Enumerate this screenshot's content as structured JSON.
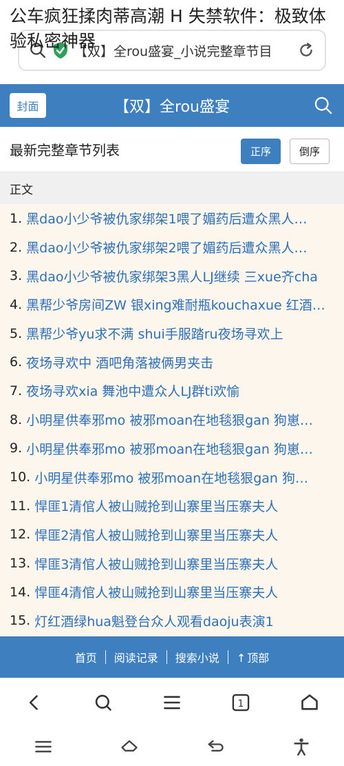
{
  "overlay_title": "公车疯狂揉肉蒂高潮 H 失禁软件：极致体验私密神器",
  "address_bar": {
    "url": "【双】全rou盛宴_小说完整章节目"
  },
  "header": {
    "cover_label": "封面",
    "title": "【双】全rou盛宴"
  },
  "list_head": {
    "title": "最新完整章节列表",
    "sort_asc": "正序",
    "sort_desc": "倒序"
  },
  "section": {
    "label": "正文"
  },
  "chapters": [
    {
      "num": "1.",
      "title": "黑dao小少爷被仇家绑架1喂了媚药后遭众黑人…"
    },
    {
      "num": "2.",
      "title": "黑dao小少爷被仇家绑架2喂了媚药后遭众黑人…"
    },
    {
      "num": "3.",
      "title": "黑dao小少爷被仇家绑架3黑人LJ继续 三xue齐cha"
    },
    {
      "num": "4.",
      "title": "黑帮少爷房间ZW 银xing难耐瓶kouchaxue 红酒…"
    },
    {
      "num": "5.",
      "title": "黑帮少爷yu求不满 shui手服踏ru夜场寻欢上"
    },
    {
      "num": "6.",
      "title": "夜场寻欢中 酒吧角落被俩男夹击"
    },
    {
      "num": "7.",
      "title": "夜场寻欢xia 舞池中遭众人LJ群ti欢愉"
    },
    {
      "num": "8.",
      "title": "小明星供奉邪mo 被邪moan在地毯狠gan 狗崽…"
    },
    {
      "num": "9.",
      "title": "小明星供奉邪mo 被邪moan在地毯狠gan 狗崽…"
    },
    {
      "num": "10.",
      "title": "小明星供奉邪mo 被邪moan在地毯狠gan 狗…"
    },
    {
      "num": "11.",
      "title": "悍匪1清倌人被山贼抢到山寨里当压寨夫人"
    },
    {
      "num": "12.",
      "title": "悍匪2清倌人被山贼抢到山寨里当压寨夫人"
    },
    {
      "num": "13.",
      "title": "悍匪3清倌人被山贼抢到山寨里当压寨夫人"
    },
    {
      "num": "14.",
      "title": "悍匪4清倌人被山贼抢到山寨里当压寨夫人"
    },
    {
      "num": "15.",
      "title": "灯红酒绿hua魁登台众人观看daoju表演1"
    }
  ],
  "footer_nav": {
    "home": "首页",
    "history": "阅读记录",
    "search": "搜索小说",
    "top": "顶部",
    "top_arrow": "↑"
  },
  "browser_bar": {
    "tab_count": "1",
    "icons": [
      "back-icon",
      "search-icon",
      "menu-icon",
      "tabs-icon",
      "home-icon"
    ]
  },
  "system_bar": {
    "icons": [
      "recents-icon",
      "home-icon",
      "back-icon",
      "accessibility-icon"
    ]
  },
  "colors": {
    "brand_blue": "#3d7fbf",
    "link_blue": "#2d6fb8",
    "list_bg": "#fdf6ec"
  }
}
